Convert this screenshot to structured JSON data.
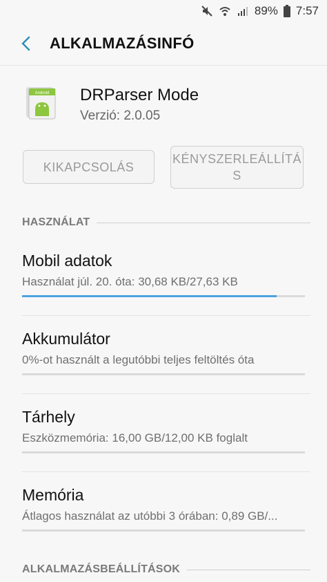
{
  "status_bar": {
    "battery_percent": "89%",
    "time": "7:57",
    "icons": [
      "mute-icon",
      "wifi-icon",
      "signal-icon",
      "battery-icon"
    ]
  },
  "header": {
    "title": "ALKALMAZÁSINFÓ"
  },
  "app": {
    "name": "DRParser Mode",
    "version": "Verzió: 2.0.05",
    "icon_text": "Android"
  },
  "buttons": {
    "disable": "KIKAPCSOLÁS",
    "force_stop_line1": "KÉNYSZERLEÁLLÍTÁ",
    "force_stop_line2": "S"
  },
  "usage": {
    "header": "HASZNÁLAT",
    "items": [
      {
        "title": "Mobil adatok",
        "subtitle": "Használat júl. 20. óta: 30,68 KB/27,63 KB",
        "progress": 0.9
      },
      {
        "title": "Akkumulátor",
        "subtitle": "0%-ot használt a legutóbbi teljes feltöltés óta",
        "progress": 0
      },
      {
        "title": "Tárhely",
        "subtitle": "Eszközmemória: 16,00 GB/12,00 KB foglalt",
        "progress": 0
      },
      {
        "title": "Memória",
        "subtitle": "Átlagos használat az utóbbi 3 órában: 0,89 GB/...",
        "progress": 0
      }
    ]
  },
  "app_settings": {
    "header": "ALKALMAZÁSBEÁLLÍTÁSOK"
  },
  "colors": {
    "accent": "#4aa3df",
    "back_arrow": "#2f8fb8"
  }
}
